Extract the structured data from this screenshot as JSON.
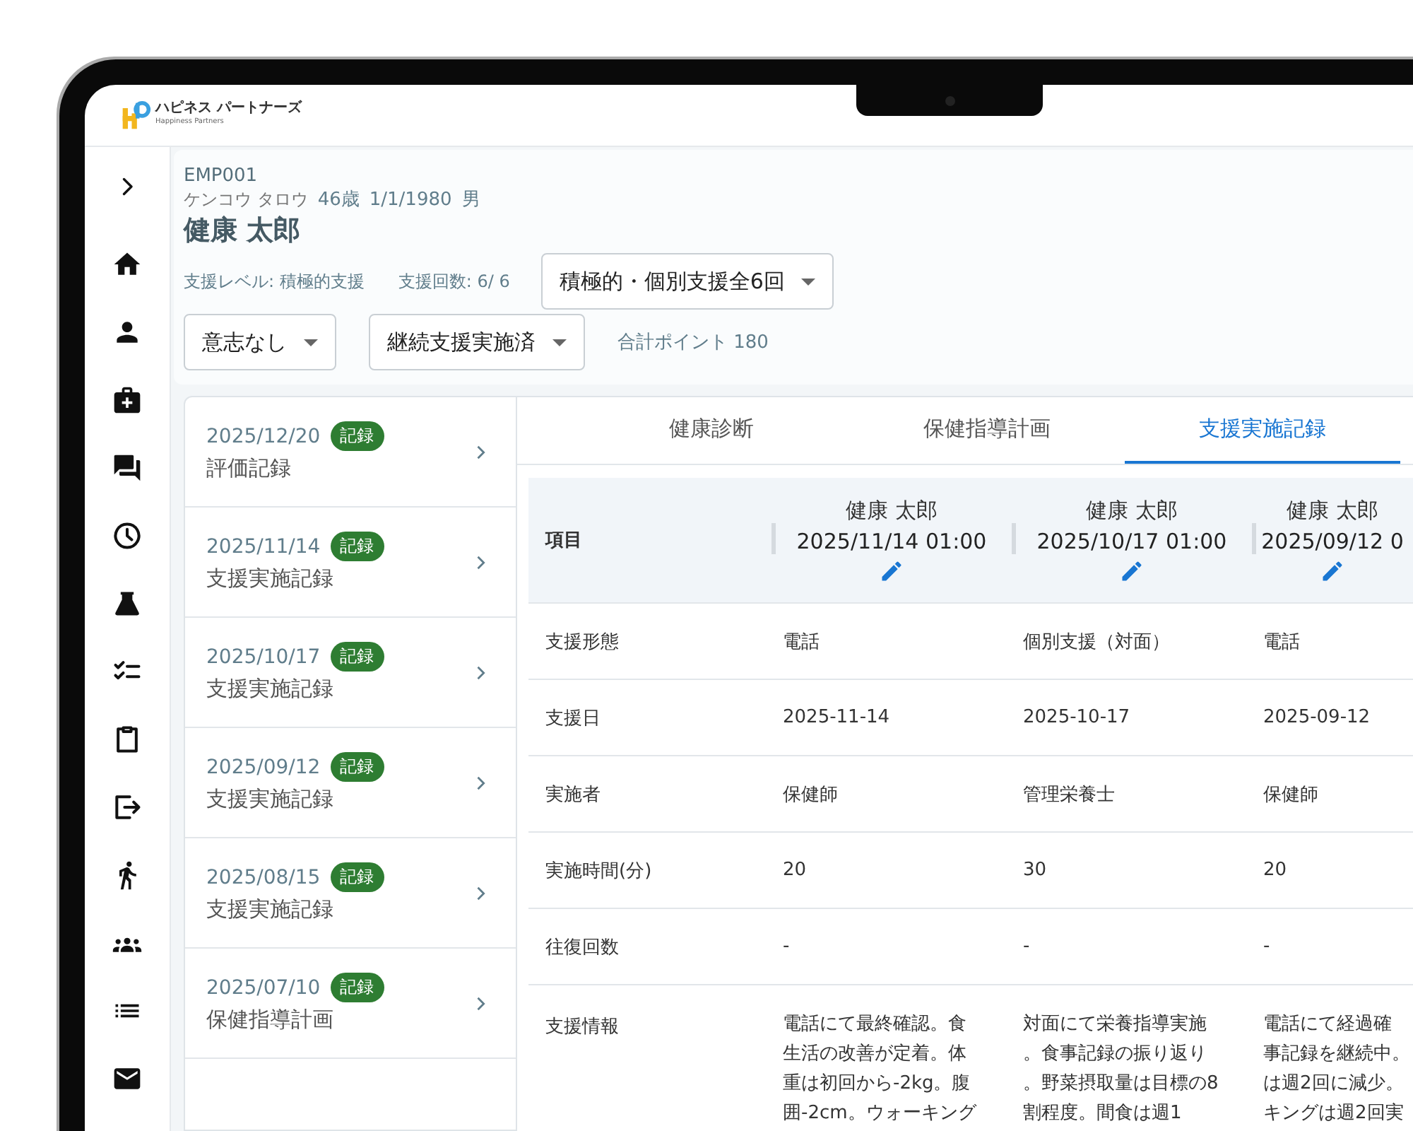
{
  "app": {
    "logo_title": "ハピネス パートナーズ",
    "logo_subtitle": "Happiness Partners"
  },
  "sidebar": {
    "items": [
      {
        "kind": "expand"
      },
      {
        "kind": "home"
      },
      {
        "kind": "person"
      },
      {
        "kind": "medical"
      },
      {
        "kind": "chat"
      },
      {
        "kind": "clock"
      },
      {
        "kind": "flask"
      },
      {
        "kind": "checklist"
      },
      {
        "kind": "clipboard"
      },
      {
        "kind": "exit"
      },
      {
        "kind": "walk"
      },
      {
        "kind": "group"
      },
      {
        "kind": "list"
      },
      {
        "kind": "mail"
      }
    ]
  },
  "patient": {
    "id": "EMP001",
    "kana": "ケンコウ タロウ",
    "age": "46歳",
    "birthdate": "1/1/1980",
    "sex": "男",
    "name": "健康 太郎",
    "support_level": "支援レベル: 積極的支援",
    "support_count": "支援回数: 6/ 6",
    "total_points": "合計ポイント 180"
  },
  "selects": [
    {
      "value": "積極的・個別支援全6回"
    },
    {
      "value": "意志なし"
    },
    {
      "value": "継続支援実施済"
    }
  ],
  "records": [
    {
      "date": "2025/12/20",
      "badge": "記録",
      "title": "評価記録"
    },
    {
      "date": "2025/11/14",
      "badge": "記録",
      "title": "支援実施記録"
    },
    {
      "date": "2025/10/17",
      "badge": "記録",
      "title": "支援実施記録"
    },
    {
      "date": "2025/09/12",
      "badge": "記録",
      "title": "支援実施記録"
    },
    {
      "date": "2025/08/15",
      "badge": "記録",
      "title": "支援実施記録"
    },
    {
      "date": "2025/07/10",
      "badge": "記録",
      "title": "保健指導計画"
    }
  ],
  "tabs": [
    {
      "label": "健康診断",
      "selected": false
    },
    {
      "label": "保健指導計画",
      "selected": false
    },
    {
      "label": "支援実施記録",
      "selected": true
    }
  ],
  "table": {
    "header_label": "項目",
    "columns": [
      {
        "name": "健康 太郎",
        "datetime": "2025/11/14 01:00"
      },
      {
        "name": "健康 太郎",
        "datetime": "2025/10/17 01:00"
      },
      {
        "name": "健康 太郎",
        "datetime": "2025/09/12 0"
      }
    ],
    "rows": [
      {
        "label": "支援形態",
        "cells": [
          "電話",
          "個別支援（対面）",
          "電話"
        ]
      },
      {
        "label": "支援日",
        "cells": [
          "2025-11-14",
          "2025-10-17",
          "2025-09-12"
        ]
      },
      {
        "label": "実施者",
        "cells": [
          "保健師",
          "管理栄養士",
          "保健師"
        ]
      },
      {
        "label": "実施時間(分)",
        "cells": [
          "20",
          "30",
          "20"
        ]
      },
      {
        "label": "往復回数",
        "cells": [
          "-",
          "-",
          "-"
        ]
      },
      {
        "label": "支援情報",
        "cells": [
          "電話にて最終確認。食生活の改善が定着。体重は初回から-2kg。腹囲-2cm。ウォーキング",
          "対面にて栄養指導実施。食事記録の振り返り。野菜摂取量は目標の8割程度。間食は週1",
          [
            "電話にて経過確",
            "事記録を継続中。",
            "は週2回に減少。",
            "キングは週2回実"
          ]
        ]
      }
    ]
  }
}
